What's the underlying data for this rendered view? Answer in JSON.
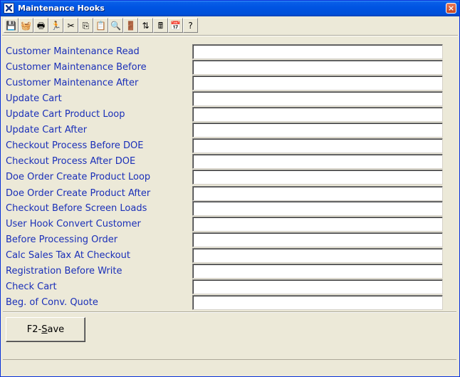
{
  "window": {
    "title": "Maintenance Hooks",
    "close_label": "×"
  },
  "toolbar": {
    "buttons": [
      {
        "name": "save-icon",
        "glyph": "💾"
      },
      {
        "name": "bucket-icon",
        "glyph": "🧺"
      },
      {
        "name": "print-icon",
        "glyph": "🖶"
      },
      {
        "name": "run-icon",
        "glyph": "🏃"
      },
      {
        "name": "cut-icon",
        "glyph": "✂"
      },
      {
        "name": "copy-icon",
        "glyph": "⎘"
      },
      {
        "name": "paste-icon",
        "glyph": "📋"
      },
      {
        "name": "find-icon",
        "glyph": "🔍"
      },
      {
        "name": "exit-door-icon",
        "glyph": "🚪"
      },
      {
        "name": "sort-icon",
        "glyph": "⇅"
      },
      {
        "name": "calculator-icon",
        "glyph": "🖩"
      },
      {
        "name": "calendar-icon",
        "glyph": "📅"
      },
      {
        "name": "help-icon",
        "glyph": "?"
      }
    ]
  },
  "fields": [
    {
      "label": "Customer Maintenance Read",
      "value": ""
    },
    {
      "label": "Customer Maintenance Before",
      "value": ""
    },
    {
      "label": "Customer Maintenance After",
      "value": ""
    },
    {
      "label": "Update Cart",
      "value": ""
    },
    {
      "label": "Update Cart Product Loop",
      "value": ""
    },
    {
      "label": "Update Cart After",
      "value": ""
    },
    {
      "label": "Checkout Process Before DOE",
      "value": ""
    },
    {
      "label": "Checkout Process After DOE",
      "value": ""
    },
    {
      "label": "Doe Order Create Product Loop",
      "value": ""
    },
    {
      "label": "Doe Order Create Product After",
      "value": ""
    },
    {
      "label": "Checkout Before Screen Loads",
      "value": ""
    },
    {
      "label": "User Hook Convert Customer",
      "value": ""
    },
    {
      "label": "Before Processing Order",
      "value": ""
    },
    {
      "label": "Calc Sales Tax At Checkout",
      "value": ""
    },
    {
      "label": "Registration Before Write",
      "value": ""
    },
    {
      "label": "Check Cart",
      "value": ""
    },
    {
      "label": "Beg. of Conv. Quote",
      "value": ""
    }
  ],
  "actions": {
    "save_label_prefix": "F2-",
    "save_label_underlined": "S",
    "save_label_suffix": "ave"
  },
  "colors": {
    "label_color": "#1a2fb8",
    "title_bar": "#0054e3",
    "window_bg": "#ece9d8"
  }
}
